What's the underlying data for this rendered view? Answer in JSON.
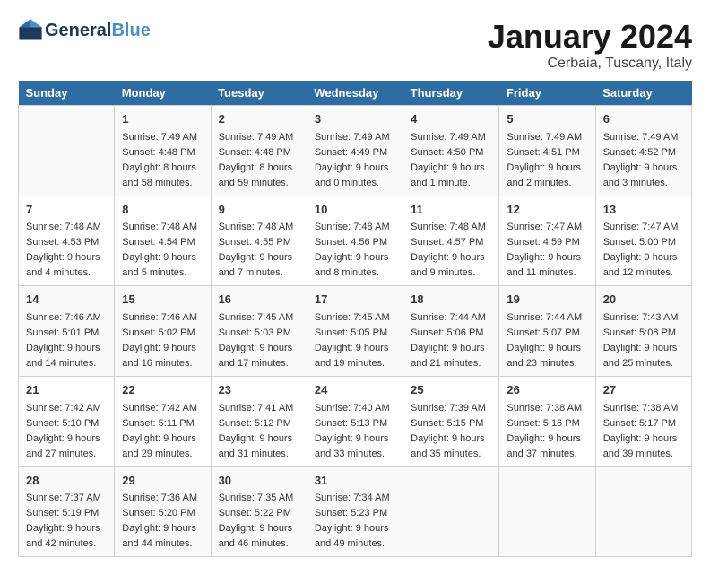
{
  "header": {
    "logo_line1": "General",
    "logo_line2": "Blue",
    "main_title": "January 2024",
    "subtitle": "Cerbaia, Tuscany, Italy"
  },
  "days_of_week": [
    "Sunday",
    "Monday",
    "Tuesday",
    "Wednesday",
    "Thursday",
    "Friday",
    "Saturday"
  ],
  "weeks": [
    [
      {
        "day": "",
        "info": ""
      },
      {
        "day": "1",
        "info": "Sunrise: 7:49 AM\nSunset: 4:48 PM\nDaylight: 8 hours\nand 58 minutes."
      },
      {
        "day": "2",
        "info": "Sunrise: 7:49 AM\nSunset: 4:48 PM\nDaylight: 8 hours\nand 59 minutes."
      },
      {
        "day": "3",
        "info": "Sunrise: 7:49 AM\nSunset: 4:49 PM\nDaylight: 9 hours\nand 0 minutes."
      },
      {
        "day": "4",
        "info": "Sunrise: 7:49 AM\nSunset: 4:50 PM\nDaylight: 9 hours\nand 1 minute."
      },
      {
        "day": "5",
        "info": "Sunrise: 7:49 AM\nSunset: 4:51 PM\nDaylight: 9 hours\nand 2 minutes."
      },
      {
        "day": "6",
        "info": "Sunrise: 7:49 AM\nSunset: 4:52 PM\nDaylight: 9 hours\nand 3 minutes."
      }
    ],
    [
      {
        "day": "7",
        "info": "Sunrise: 7:48 AM\nSunset: 4:53 PM\nDaylight: 9 hours\nand 4 minutes."
      },
      {
        "day": "8",
        "info": "Sunrise: 7:48 AM\nSunset: 4:54 PM\nDaylight: 9 hours\nand 5 minutes."
      },
      {
        "day": "9",
        "info": "Sunrise: 7:48 AM\nSunset: 4:55 PM\nDaylight: 9 hours\nand 7 minutes."
      },
      {
        "day": "10",
        "info": "Sunrise: 7:48 AM\nSunset: 4:56 PM\nDaylight: 9 hours\nand 8 minutes."
      },
      {
        "day": "11",
        "info": "Sunrise: 7:48 AM\nSunset: 4:57 PM\nDaylight: 9 hours\nand 9 minutes."
      },
      {
        "day": "12",
        "info": "Sunrise: 7:47 AM\nSunset: 4:59 PM\nDaylight: 9 hours\nand 11 minutes."
      },
      {
        "day": "13",
        "info": "Sunrise: 7:47 AM\nSunset: 5:00 PM\nDaylight: 9 hours\nand 12 minutes."
      }
    ],
    [
      {
        "day": "14",
        "info": "Sunrise: 7:46 AM\nSunset: 5:01 PM\nDaylight: 9 hours\nand 14 minutes."
      },
      {
        "day": "15",
        "info": "Sunrise: 7:46 AM\nSunset: 5:02 PM\nDaylight: 9 hours\nand 16 minutes."
      },
      {
        "day": "16",
        "info": "Sunrise: 7:45 AM\nSunset: 5:03 PM\nDaylight: 9 hours\nand 17 minutes."
      },
      {
        "day": "17",
        "info": "Sunrise: 7:45 AM\nSunset: 5:05 PM\nDaylight: 9 hours\nand 19 minutes."
      },
      {
        "day": "18",
        "info": "Sunrise: 7:44 AM\nSunset: 5:06 PM\nDaylight: 9 hours\nand 21 minutes."
      },
      {
        "day": "19",
        "info": "Sunrise: 7:44 AM\nSunset: 5:07 PM\nDaylight: 9 hours\nand 23 minutes."
      },
      {
        "day": "20",
        "info": "Sunrise: 7:43 AM\nSunset: 5:08 PM\nDaylight: 9 hours\nand 25 minutes."
      }
    ],
    [
      {
        "day": "21",
        "info": "Sunrise: 7:42 AM\nSunset: 5:10 PM\nDaylight: 9 hours\nand 27 minutes."
      },
      {
        "day": "22",
        "info": "Sunrise: 7:42 AM\nSunset: 5:11 PM\nDaylight: 9 hours\nand 29 minutes."
      },
      {
        "day": "23",
        "info": "Sunrise: 7:41 AM\nSunset: 5:12 PM\nDaylight: 9 hours\nand 31 minutes."
      },
      {
        "day": "24",
        "info": "Sunrise: 7:40 AM\nSunset: 5:13 PM\nDaylight: 9 hours\nand 33 minutes."
      },
      {
        "day": "25",
        "info": "Sunrise: 7:39 AM\nSunset: 5:15 PM\nDaylight: 9 hours\nand 35 minutes."
      },
      {
        "day": "26",
        "info": "Sunrise: 7:38 AM\nSunset: 5:16 PM\nDaylight: 9 hours\nand 37 minutes."
      },
      {
        "day": "27",
        "info": "Sunrise: 7:38 AM\nSunset: 5:17 PM\nDaylight: 9 hours\nand 39 minutes."
      }
    ],
    [
      {
        "day": "28",
        "info": "Sunrise: 7:37 AM\nSunset: 5:19 PM\nDaylight: 9 hours\nand 42 minutes."
      },
      {
        "day": "29",
        "info": "Sunrise: 7:36 AM\nSunset: 5:20 PM\nDaylight: 9 hours\nand 44 minutes."
      },
      {
        "day": "30",
        "info": "Sunrise: 7:35 AM\nSunset: 5:22 PM\nDaylight: 9 hours\nand 46 minutes."
      },
      {
        "day": "31",
        "info": "Sunrise: 7:34 AM\nSunset: 5:23 PM\nDaylight: 9 hours\nand 49 minutes."
      },
      {
        "day": "",
        "info": ""
      },
      {
        "day": "",
        "info": ""
      },
      {
        "day": "",
        "info": ""
      }
    ]
  ]
}
